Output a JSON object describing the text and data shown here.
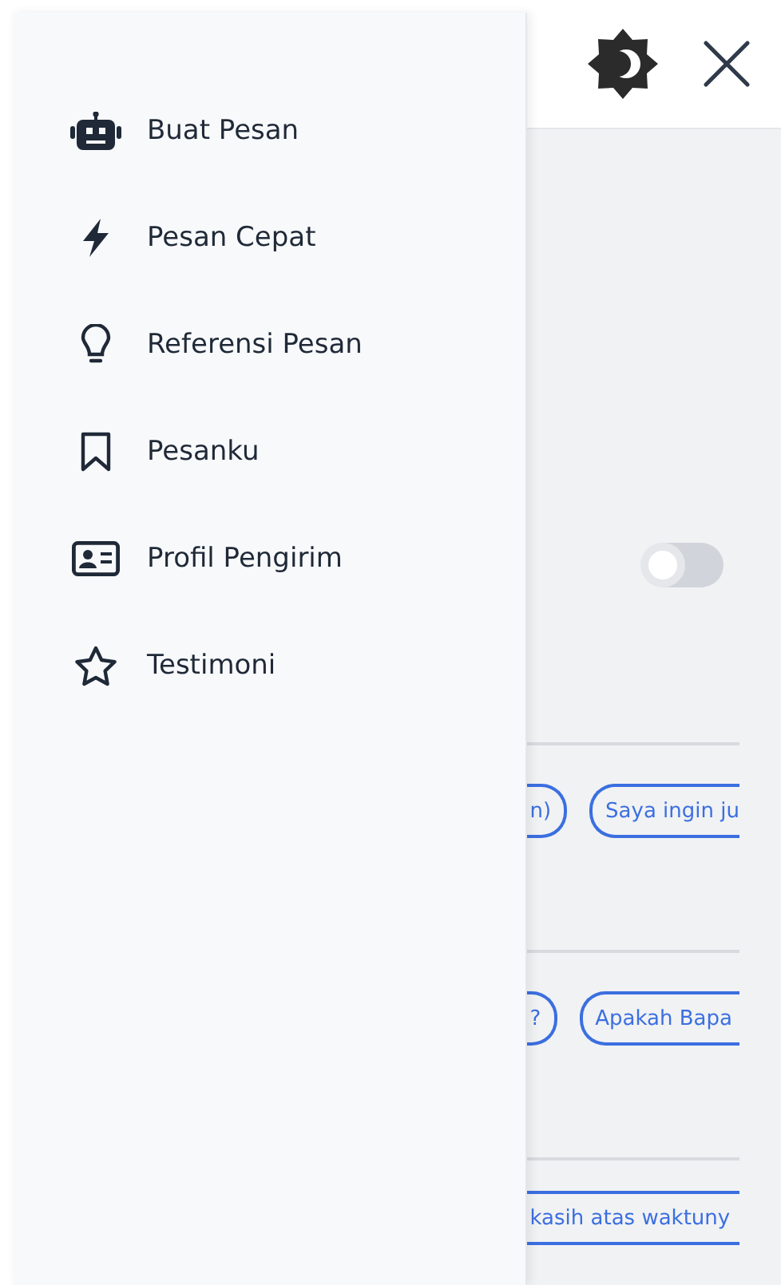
{
  "drawer": {
    "items": [
      {
        "label": "Buat Pesan"
      },
      {
        "label": "Pesan Cepat"
      },
      {
        "label": "Referensi Pesan"
      },
      {
        "label": "Pesanku"
      },
      {
        "label": "Profil Pengirim"
      },
      {
        "label": "Testimoni"
      }
    ]
  },
  "content": {
    "switch": {
      "on": false
    },
    "chip_rows": [
      {
        "chips": [
          {
            "label": "n)",
            "kind": "left"
          },
          {
            "label": "Saya ingin ju",
            "kind": "right"
          }
        ]
      },
      {
        "chips": [
          {
            "label": "?",
            "kind": "left"
          },
          {
            "label": "Apakah Bapa",
            "kind": "right"
          }
        ]
      },
      {
        "chips": [
          {
            "label": "kasih atas waktuny",
            "kind": "both"
          }
        ]
      }
    ]
  }
}
